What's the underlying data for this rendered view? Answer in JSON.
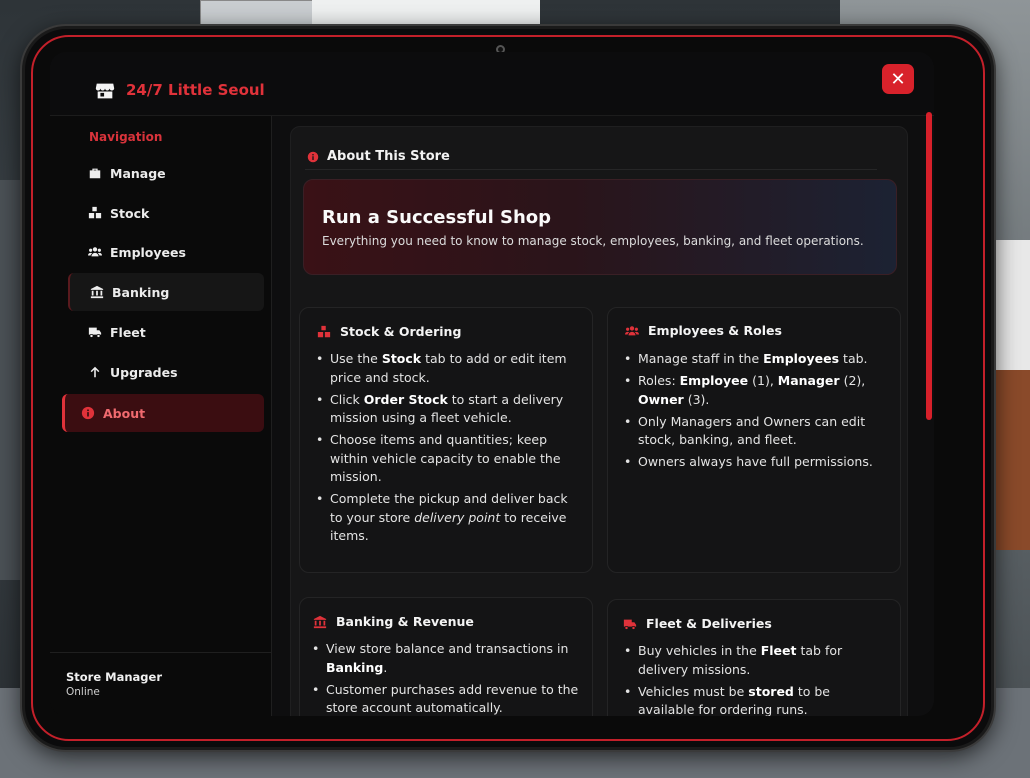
{
  "app": {
    "title": "24/7 Little Seoul",
    "close_label": "✕"
  },
  "sidebar": {
    "heading": "Navigation",
    "items": [
      {
        "label": "Manage",
        "icon": "briefcase-icon"
      },
      {
        "label": "Stock",
        "icon": "boxes-icon"
      },
      {
        "label": "Employees",
        "icon": "users-icon"
      },
      {
        "label": "Banking",
        "icon": "bank-icon"
      },
      {
        "label": "Fleet",
        "icon": "truck-icon"
      },
      {
        "label": "Upgrades",
        "icon": "arrow-up-icon"
      },
      {
        "label": "About",
        "icon": "info-icon"
      }
    ],
    "active": "About",
    "footer": {
      "role": "Store Manager",
      "status": "Online"
    }
  },
  "about": {
    "heading": "About This Store",
    "hero_title": "Run a Successful Shop",
    "hero_subtitle": "Everything you need to know to manage stock, employees, banking, and fleet operations."
  },
  "cards": {
    "stock": {
      "title": "Stock & Ordering",
      "b1": [
        "Use the ",
        "Stock",
        " tab to add or edit item price and stock."
      ],
      "b2": [
        "Click ",
        "Order Stock",
        " to start a delivery mission using a fleet vehicle."
      ],
      "b3": "Choose items and quantities; keep within vehicle capacity to enable the mission.",
      "b4": [
        "Complete the pickup and deliver back to your store ",
        "delivery point",
        " to receive items."
      ]
    },
    "employees": {
      "title": "Employees & Roles",
      "b1": [
        "Manage staff in the ",
        "Employees",
        " tab."
      ],
      "b2": [
        "Roles: ",
        "Employee",
        " (1), ",
        "Manager",
        " (2), ",
        "Owner",
        " (3)."
      ],
      "b3": "Only Managers and Owners can edit stock, banking, and fleet.",
      "b4": "Owners always have full permissions."
    },
    "banking": {
      "title": "Banking & Revenue",
      "b1": [
        "View store balance and transactions in ",
        "Banking",
        "."
      ],
      "b2": "Customer purchases add revenue to the store account automatically."
    },
    "fleet": {
      "title": "Fleet & Deliveries",
      "b1": [
        "Buy vehicles in the ",
        "Fleet",
        " tab for delivery missions."
      ],
      "b2": [
        "Vehicles must be ",
        "stored",
        " to be available for ordering runs."
      ]
    }
  },
  "colors": {
    "accent": "#e0323a",
    "active_bg": "#3b0d11"
  }
}
